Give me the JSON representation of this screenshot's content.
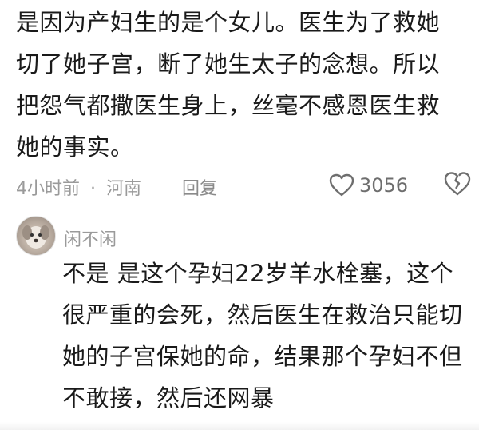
{
  "comment": {
    "lines": [
      "是因为产妇生的是个女儿。医生为了救她",
      "切了她子宫，断了她生太子的念想。所以",
      "把怨气都撒医生身上，丝毫不感恩医生救",
      "她的事实。"
    ],
    "time": "4小时前",
    "separator": "·",
    "location": "河南",
    "reply_label": "回复",
    "like_count": "3056"
  },
  "reply": {
    "username": "闲不闲",
    "lines": [
      "不是 是这个孕妇22岁羊水栓塞，这个",
      "很严重的会死，然后医生在救治只能切",
      "她的子宫保她的命，结果那个孕妇不但",
      "不敢接，然后还网暴"
    ]
  },
  "icons": {
    "like": "heart-outline-icon",
    "dislike": "broken-heart-icon",
    "avatar": "user-avatar-dog"
  },
  "colors": {
    "text": "#1a1a1a",
    "meta": "#9a9a9a",
    "icon": "#6e6e6e",
    "background": "#ffffff"
  }
}
